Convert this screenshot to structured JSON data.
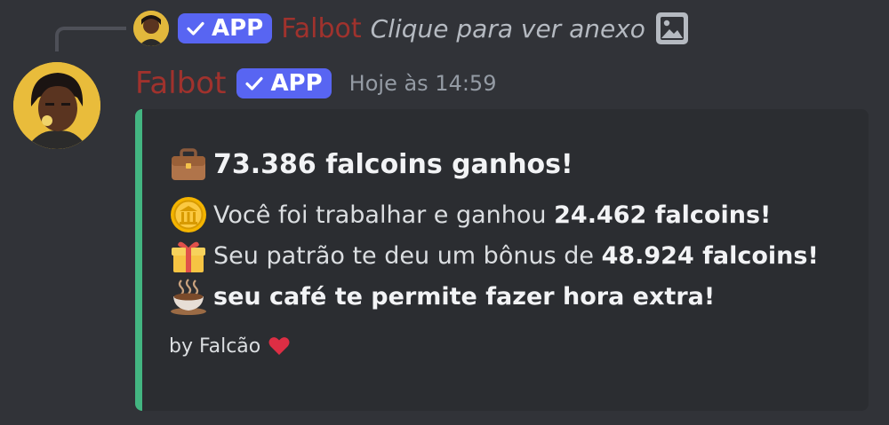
{
  "reply": {
    "badge_label": "APP",
    "author": "Falbot",
    "text": "Clique para ver anexo",
    "icon": "image-icon"
  },
  "message": {
    "author": "Falbot",
    "badge_label": "APP",
    "timestamp": "Hoje às 14:59",
    "author_color": "#a0322d",
    "badge_color": "#5865f2"
  },
  "embed": {
    "accent_color": "#43b581",
    "title_icon": "briefcase-icon",
    "title": "73.386 falcoins ganhos!",
    "lines": [
      {
        "icon": "coin-icon",
        "text": "Você foi trabalhar e ganhou ",
        "bold": "24.462 falcoins!"
      },
      {
        "icon": "gift-icon",
        "text": "Seu patrão te deu um bônus de ",
        "bold": "48.924 falcoins!"
      },
      {
        "icon": "coffee-icon",
        "text": "",
        "bold": "seu café te permite fazer hora extra!"
      }
    ],
    "footer": "by Falcão",
    "footer_icon": "heart-icon"
  }
}
